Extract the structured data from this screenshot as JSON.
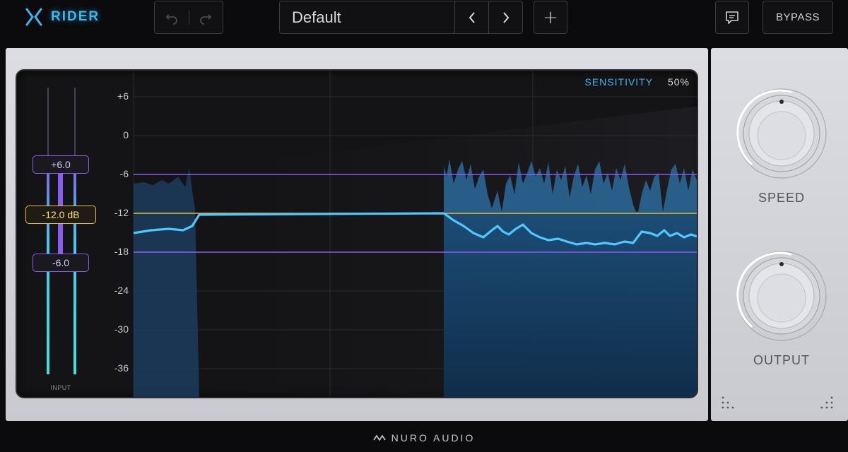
{
  "app": {
    "name": "RIDER",
    "brand_color": "#3fb6f0"
  },
  "header": {
    "undo_icon": "undo-icon",
    "redo_icon": "redo-icon",
    "preset_name": "Default",
    "prev_icon": "chevron-left-icon",
    "next_icon": "chevron-right-icon",
    "add_label": "+",
    "feedback_icon": "chat-bubble-icon",
    "bypass_label": "BYPASS"
  },
  "display": {
    "sensitivity_label": "SENSITIVITY",
    "sensitivity_value": "50%",
    "y_ticks": [
      "+6",
      "0",
      "-6",
      "-12",
      "-18",
      "-24",
      "-30",
      "-36"
    ],
    "upper_range": "+6.0",
    "target_level": "-12.0 dB",
    "lower_range": "-6.0",
    "input_label": "INPUT",
    "colors": {
      "range_line": "#8a5cf0",
      "target_line": "#e0c040",
      "gain_line": "#4fc8ff",
      "input_meter": "#4fd8f0"
    }
  },
  "controls": {
    "speed_label": "SPEED",
    "output_label": "OUTPUT"
  },
  "footer": {
    "brand": "NURO AUDIO"
  }
}
